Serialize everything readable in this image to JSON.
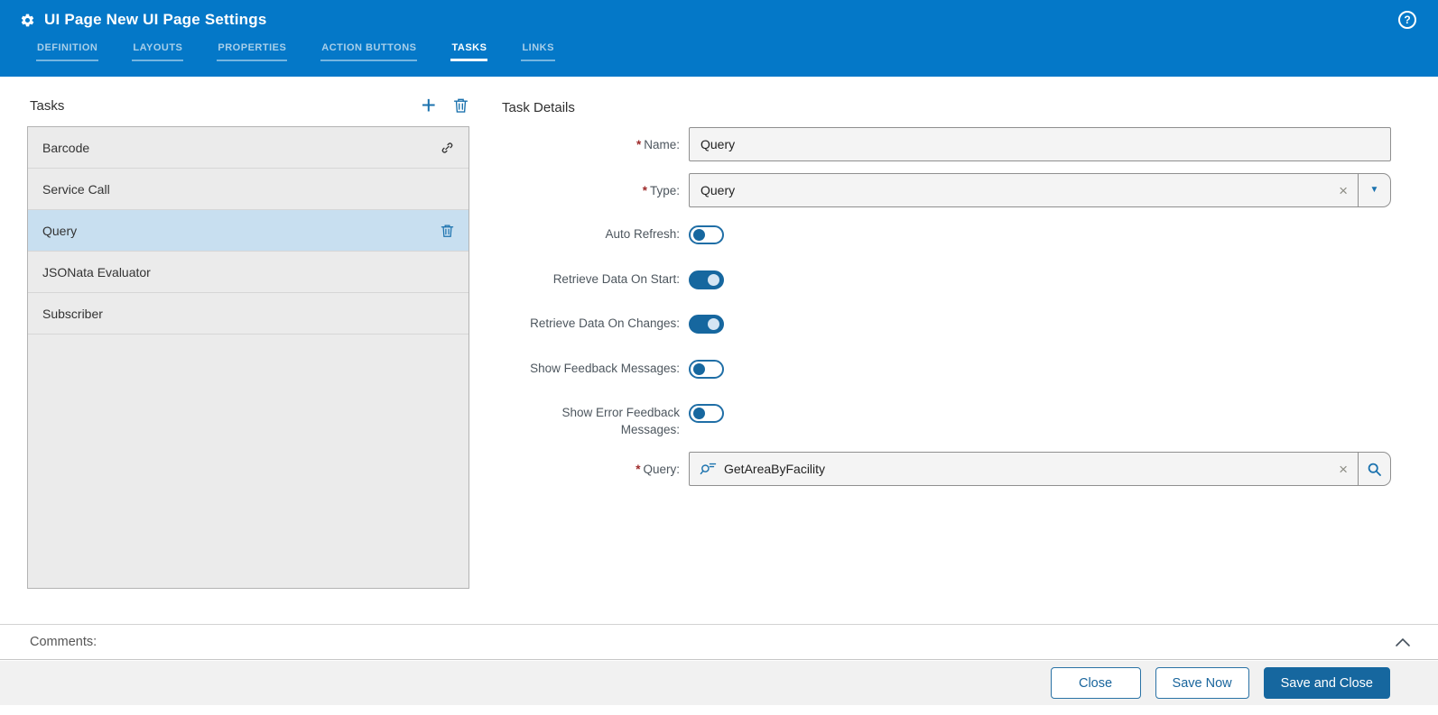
{
  "colors": {
    "header_blue": "#0478c8",
    "accent_blue": "#1b72ae",
    "primary_blue": "#16679f",
    "selected_row": "#c8dff0"
  },
  "icons": {
    "help": "?",
    "plus": "+",
    "caret": "▼",
    "clear": "×"
  },
  "header": {
    "title": "UI Page New UI Page Settings",
    "tabs": [
      {
        "label": "DEFINITION",
        "active": false
      },
      {
        "label": "LAYOUTS",
        "active": false
      },
      {
        "label": "PROPERTIES",
        "active": false
      },
      {
        "label": "ACTION BUTTONS",
        "active": false
      },
      {
        "label": "TASKS",
        "active": true
      },
      {
        "label": "LINKS",
        "active": false
      }
    ]
  },
  "tasks_panel": {
    "title": "Tasks",
    "items": [
      {
        "label": "Barcode",
        "icon": "link",
        "selected": false
      },
      {
        "label": "Service Call",
        "icon": "",
        "selected": false
      },
      {
        "label": "Query",
        "icon": "trash",
        "selected": true
      },
      {
        "label": "JSONata Evaluator",
        "icon": "",
        "selected": false
      },
      {
        "label": "Subscriber",
        "icon": "",
        "selected": false
      }
    ]
  },
  "task_details": {
    "title": "Task Details",
    "required_marker": "*",
    "fields": {
      "name": {
        "label": "Name:",
        "value": "Query"
      },
      "type": {
        "label": "Type:",
        "value": "Query"
      },
      "auto_refresh": {
        "label": "Auto Refresh:",
        "value": false
      },
      "retrieve_on_start": {
        "label": "Retrieve Data On Start:",
        "value": true
      },
      "retrieve_on_changes": {
        "label": "Retrieve Data On Changes:",
        "value": true
      },
      "show_feedback": {
        "label": "Show Feedback Messages:",
        "value": false
      },
      "show_error_feedback": {
        "label": "Show Error Feedback Messages:",
        "value": false
      },
      "query": {
        "label": "Query:",
        "value": "GetAreaByFacility"
      }
    }
  },
  "comments": {
    "label": "Comments:"
  },
  "footer": {
    "buttons": [
      {
        "label": "Close",
        "style": "secondary"
      },
      {
        "label": "Save Now",
        "style": "secondary"
      },
      {
        "label": "Save and Close",
        "style": "primary"
      }
    ]
  }
}
